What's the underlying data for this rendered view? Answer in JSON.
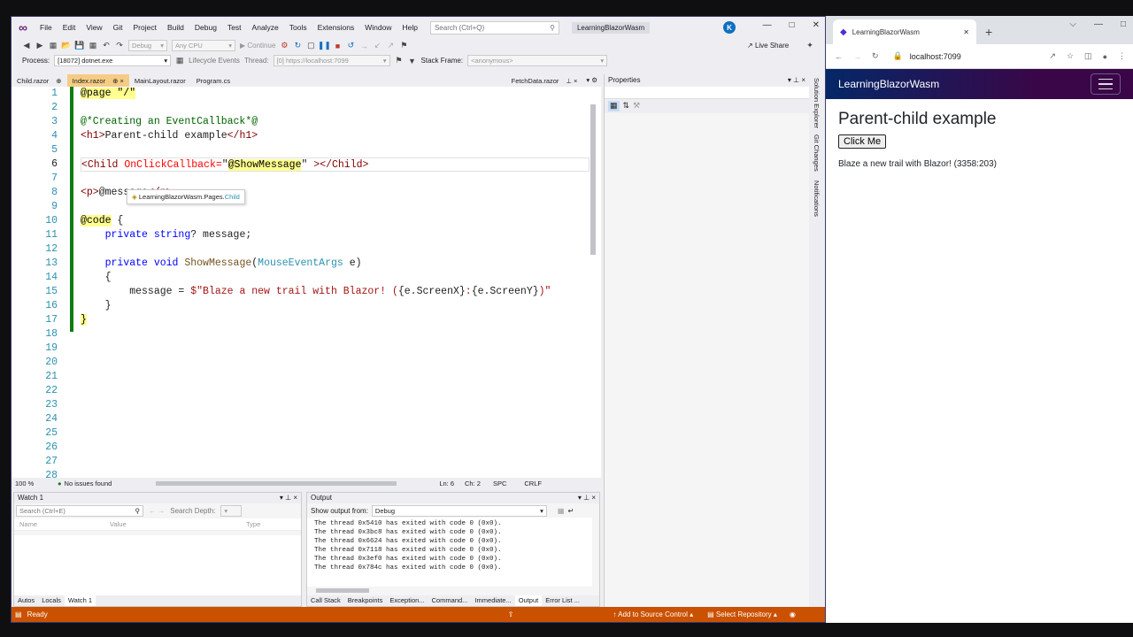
{
  "vs": {
    "menu": [
      "File",
      "Edit",
      "View",
      "Git",
      "Project",
      "Build",
      "Debug",
      "Test",
      "Analyze",
      "Tools",
      "Extensions",
      "Window",
      "Help"
    ],
    "search_placeholder": "Search (Ctrl+Q)",
    "solution_name": "LearningBlazorWasm",
    "avatar": "K",
    "toolbar": {
      "config": "Debug",
      "platform": "Any CPU",
      "continue": "Continue",
      "live_share": "Live Share"
    },
    "toolbar2": {
      "process_label": "Process:",
      "process": "[18072] dotnet.exe",
      "lifecycle": "Lifecycle Events",
      "thread_label": "Thread:",
      "thread": "[0] https://localhost:7099",
      "stack_label": "Stack Frame:",
      "stack": "<anonymous>"
    },
    "tabs": [
      {
        "label": "Child.razor",
        "pin": "⊕",
        "active": false
      },
      {
        "label": "Index.razor",
        "pin": "⊕ ×",
        "active": true
      },
      {
        "label": "MainLayout.razor",
        "pin": "",
        "active": false
      },
      {
        "label": "Program.cs",
        "pin": "",
        "active": false
      }
    ],
    "right_tab": "FetchData.razor",
    "line_numbers": [
      "1",
      "2",
      "3",
      "4",
      "5",
      "6",
      "7",
      "8",
      "9",
      "10",
      "11",
      "12",
      "13",
      "14",
      "15",
      "16",
      "17",
      "18",
      "19",
      "20",
      "21",
      "22",
      "23",
      "24",
      "25",
      "26",
      "27",
      "28"
    ],
    "code": {
      "l1": "@page \"/\"",
      "l3": "@*Creating an EventCallback*@",
      "l4a": "<h1>",
      "l4b": "Parent-child example",
      "l4c": "</h1>",
      "l6a": "<Child",
      "l6b": " OnClickCallback=",
      "l6c": "\"",
      "l6d": "@ShowMessage",
      "l6e": "\" ",
      "l6f": "></Child>",
      "l8a": "<p>",
      "l8b": "@message",
      "l8c": "</p>",
      "l10a": "@code",
      "l10b": " {",
      "l11a": "    private ",
      "l11b": "string",
      "l11c": "? message;",
      "l13a": "    private ",
      "l13b": "void ",
      "l13c": "ShowMessage",
      "l13d": "(",
      "l13e": "MouseEventArgs",
      "l13f": " e)",
      "l14": "    {",
      "l15a": "        message = ",
      "l15b": "$\"Blaze a new trail with Blazor! (",
      "l15c": "{e.ScreenX}",
      "l15d": ":",
      "l15e": "{e.ScreenY}",
      "l15f": ")\"",
      "l16": "    }",
      "l17": "}"
    },
    "tooltip": {
      "ns": "LearningBlazorWasm.Pages.",
      "type": "Child"
    },
    "status": {
      "zoom": "100 %",
      "issues": "No issues found",
      "ln": "Ln: 6",
      "ch": "Ch: 2",
      "spc": "SPC",
      "crlf": "CRLF"
    },
    "properties_title": "Properties",
    "side_tabs": [
      "Solution Explorer",
      "Git Changes",
      "Notifications"
    ],
    "watch": {
      "title": "Watch 1",
      "search": "Search (Ctrl+E)",
      "depth": "Search Depth:",
      "cols": [
        "Name",
        "Value",
        "Type"
      ],
      "tabs": [
        "Autos",
        "Locals",
        "Watch 1"
      ]
    },
    "output": {
      "title": "Output",
      "show_from": "Show output from:",
      "source": "Debug",
      "lines": [
        "The thread 0x5410 has exited with code 0 (0x0).",
        "The thread 0x3bc8 has exited with code 0 (0x0).",
        "The thread 0x6624 has exited with code 0 (0x0).",
        "The thread 0x7118 has exited with code 0 (0x0).",
        "The thread 0x3ef0 has exited with code 0 (0x0).",
        "The thread 0x784c has exited with code 0 (0x0)."
      ],
      "tabs": [
        "Call Stack",
        "Breakpoints",
        "Exception...",
        "Command...",
        "Immediate...",
        "Output",
        "Error List ..."
      ]
    },
    "statusbar": {
      "ready": "Ready",
      "source_control": "Add to Source Control",
      "repo": "Select Repository"
    }
  },
  "browser": {
    "tab_title": "LearningBlazorWasm",
    "url": "localhost:7099",
    "brand": "LearningBlazorWasm",
    "heading": "Parent-child example",
    "button": "Click Me",
    "message": "Blaze a new trail with Blazor! (3358:203)"
  },
  "colors": {
    "vs_accent": "#68217a",
    "status_bar": "#ca5100",
    "active_tab": "#f5cc84",
    "nav_gradient_start": "#052767",
    "nav_gradient_end": "#3a0647"
  }
}
